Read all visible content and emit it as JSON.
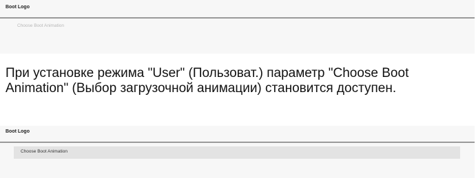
{
  "before": {
    "title": "Boot Logo",
    "option": "Choose Boot Animation"
  },
  "description": "При установке режима \"User\" (Пользоват.) параметр \"Choose Boot Animation\" (Выбор загрузочной анимации) становится доступен.",
  "after": {
    "title": "Boot Logo",
    "option": "Choose Boot Animation"
  }
}
